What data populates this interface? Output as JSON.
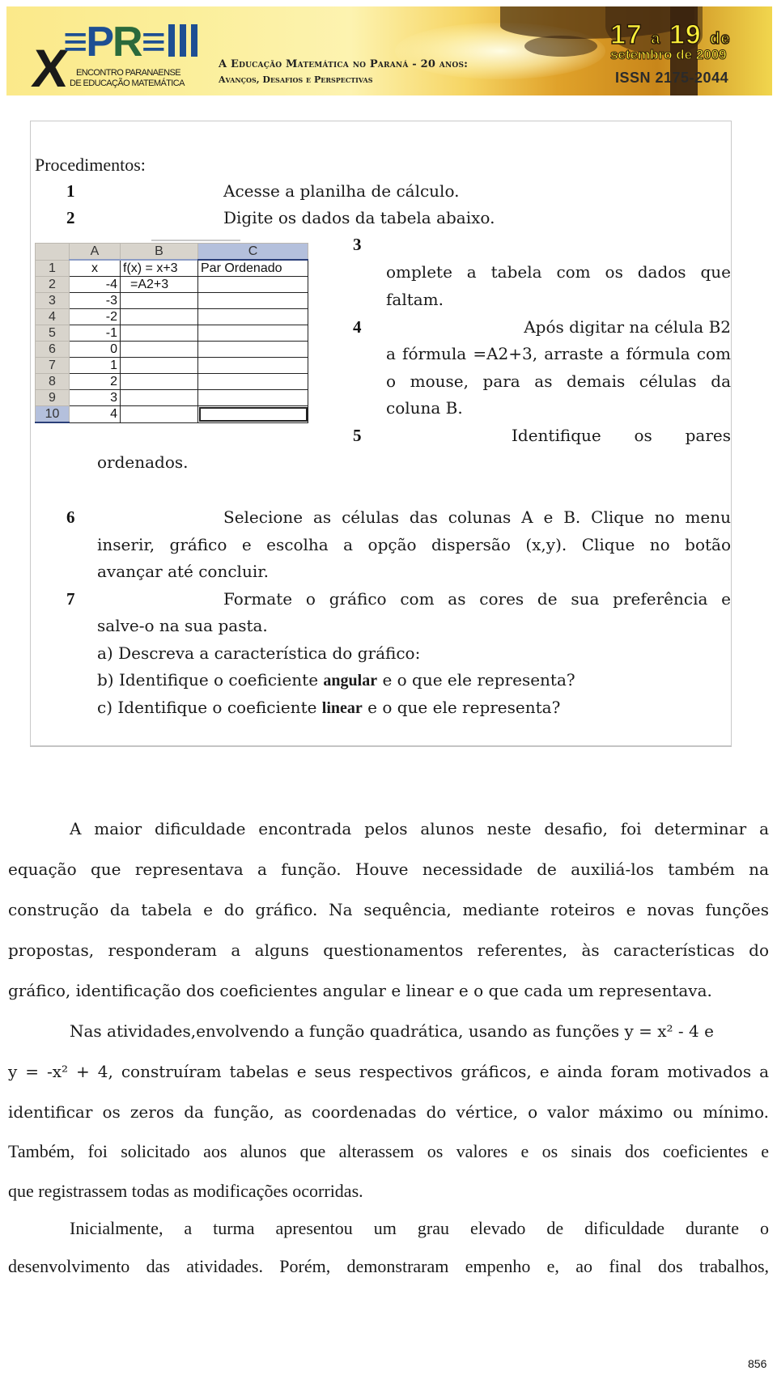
{
  "banner": {
    "logo_prefix": "X",
    "logo_main": "EPREM",
    "logo_subtitle_line1": "Encontro Paranaense",
    "logo_subtitle_line2": "de Educação Matemática",
    "tagline_1": "A Educação Matemática no Paraná - 20 anos:",
    "tagline_2": "Avanços, Desafios e Perspectivas",
    "date_line1_a": "17",
    "date_line1_b": "a",
    "date_line1_c": "19",
    "date_line1_d": "de",
    "date_line2": "setembro de 2009",
    "issn": "ISSN  2175-2044",
    "colors": {
      "logo_blue": "#1e4f93",
      "logo_green": "#2b6a3c",
      "date_yellow": "#fff23a",
      "banner_base": "#fbe98a"
    }
  },
  "procedures": {
    "heading": "Procedimentos:",
    "steps": [
      {
        "num": "1",
        "text": "Acesse a planilha de cálculo."
      },
      {
        "num": "2",
        "text": "Digite os dados da tabela abaixo."
      },
      {
        "num": "3",
        "lines": [
          "omplete a tabela com os dados que",
          "faltam."
        ]
      },
      {
        "num": "4",
        "lines": [
          "Após digitar na célula B2",
          "a fórmula =A2+3, arraste a fórmula com",
          "o mouse, para as demais células da",
          "coluna B."
        ]
      },
      {
        "num": "5",
        "lines": [
          "Identifique os pares",
          "ordenados."
        ]
      },
      {
        "num": "6",
        "lines": [
          "Selecione as células das colunas A e B. Clique no menu",
          "inserir, gráfico e escolha a opção dispersão (x,y). Clique no botão",
          "avançar até concluir."
        ]
      },
      {
        "num": "7",
        "lines": [
          "Formate o gráfico com as cores de sua preferência e",
          "salve-o na sua pasta."
        ]
      }
    ],
    "questions": {
      "a": "a) Descreva a característica do gráfico:",
      "b_pre": "b) Identifique o coeficiente ",
      "b_bold": "angular",
      "b_post": " e o que ele representa?",
      "c_pre": "c) Identifique o coeficiente ",
      "c_bold": "linear",
      "c_post": " e o que ele representa?"
    }
  },
  "spreadsheet": {
    "column_headers": [
      "A",
      "B",
      "C"
    ],
    "selected_column": "C",
    "rows": [
      {
        "row": "1",
        "a": "x",
        "b": "f(x) = x+3",
        "c": "Par Ordenado"
      },
      {
        "row": "2",
        "a": "-4",
        "b": "=A2+3",
        "c": ""
      },
      {
        "row": "3",
        "a": "-3",
        "b": "",
        "c": ""
      },
      {
        "row": "4",
        "a": "-2",
        "b": "",
        "c": ""
      },
      {
        "row": "5",
        "a": "-1",
        "b": "",
        "c": ""
      },
      {
        "row": "6",
        "a": "0",
        "b": "",
        "c": ""
      },
      {
        "row": "7",
        "a": "1",
        "b": "",
        "c": ""
      },
      {
        "row": "8",
        "a": "2",
        "b": "",
        "c": ""
      },
      {
        "row": "9",
        "a": "3",
        "b": "",
        "c": ""
      },
      {
        "row": "10",
        "a": "4",
        "b": "",
        "c": ""
      }
    ],
    "active_cell": "C10"
  },
  "body": {
    "para1": [
      "A maior dificuldade encontrada pelos alunos neste desafio, foi determinar a",
      "equação que representava a função. Houve necessidade de auxiliá-los também na",
      "construção da tabela e do gráfico. Na sequência, mediante roteiros e novas funções",
      "propostas, responderam a alguns questionamentos referentes, às características do",
      "gráfico, identificação dos coeficientes angular e linear e o que cada um representava."
    ],
    "para2": [
      "Nas atividades,envolvendo a função quadrática, usando as funções y = x² - 4 e",
      "y = -x² + 4, construíram tabelas e seus respectivos gráficos, e ainda foram motivados a",
      "identificar os zeros da função, as coordenadas do vértice, o valor máximo ou mínimo.",
      "Também, foi solicitado aos alunos que alterassem os valores e os sinais dos coeficientes e",
      "que registrassem todas as modificações ocorridas."
    ],
    "para3": [
      "Inicialmente, a turma apresentou um grau elevado de dificuldade durante o",
      "desenvolvimento das atividades. Porém, demonstraram empenho e, ao final dos trabalhos,"
    ]
  },
  "page_number": "856"
}
